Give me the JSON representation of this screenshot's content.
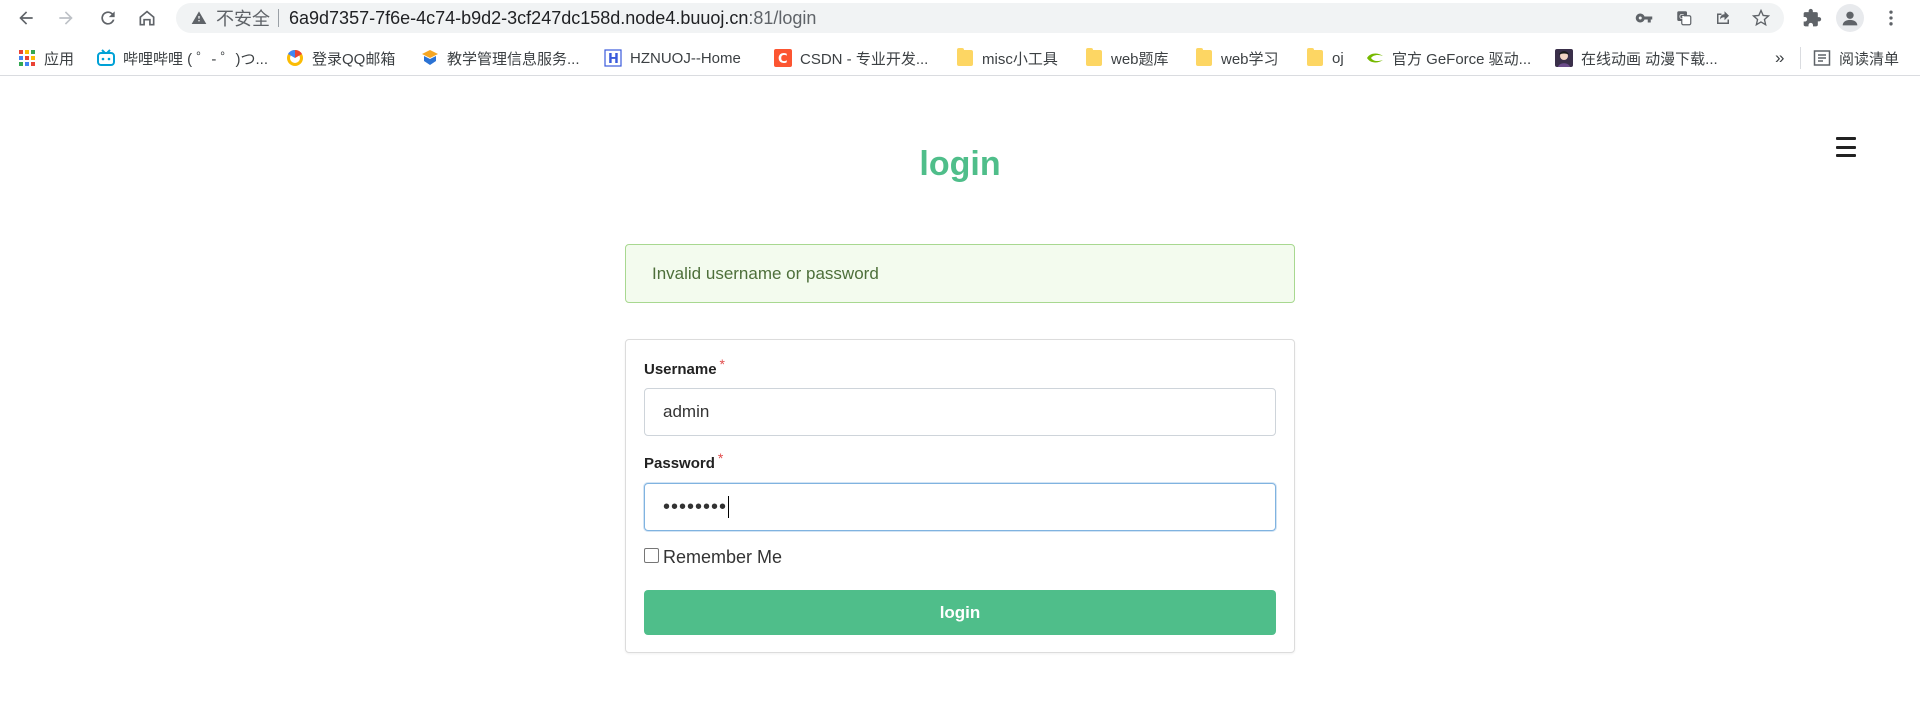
{
  "browser": {
    "security_label": "不安全",
    "url_host": "6a9d7357-7f6e-4c74-b9d2-3cf247dc158d.node4.buuoj.cn",
    "url_path": ":81/login"
  },
  "bookmarks": [
    {
      "label": "应用",
      "icon": "apps-grid-icon"
    },
    {
      "label": "哔哩哔哩 ( ゜- ゜)つ...",
      "icon": "bilibili-icon"
    },
    {
      "label": "登录QQ邮箱",
      "icon": "qq-mail-icon"
    },
    {
      "label": "教学管理信息服务...",
      "icon": "school-icon"
    },
    {
      "label": "HZNUOJ--Home",
      "icon": "hznuoj-icon"
    },
    {
      "label": "CSDN - 专业开发...",
      "icon": "csdn-icon"
    },
    {
      "label": "misc小工具",
      "icon": "folder-icon"
    },
    {
      "label": "web题库",
      "icon": "folder-icon"
    },
    {
      "label": "web学习",
      "icon": "folder-icon"
    },
    {
      "label": "oj",
      "icon": "folder-icon"
    },
    {
      "label": "官方 GeForce 驱动...",
      "icon": "nvidia-icon"
    },
    {
      "label": "在线动画 动漫下载...",
      "icon": "anime-icon"
    }
  ],
  "bookmarks_overflow": "»",
  "reading_list_label": "阅读清单",
  "page": {
    "title": "login",
    "alert": "Invalid username or password",
    "username_label": "Username",
    "username_value": "admin",
    "password_label": "Password",
    "password_mask": "••••••••",
    "required_mark": "*",
    "remember_label": "Remember Me",
    "submit_label": "login"
  },
  "colors": {
    "accent": "#4fbe8a",
    "alert_bg": "#f3fbee",
    "alert_border": "#a8d890",
    "required": "#e14c4c"
  }
}
